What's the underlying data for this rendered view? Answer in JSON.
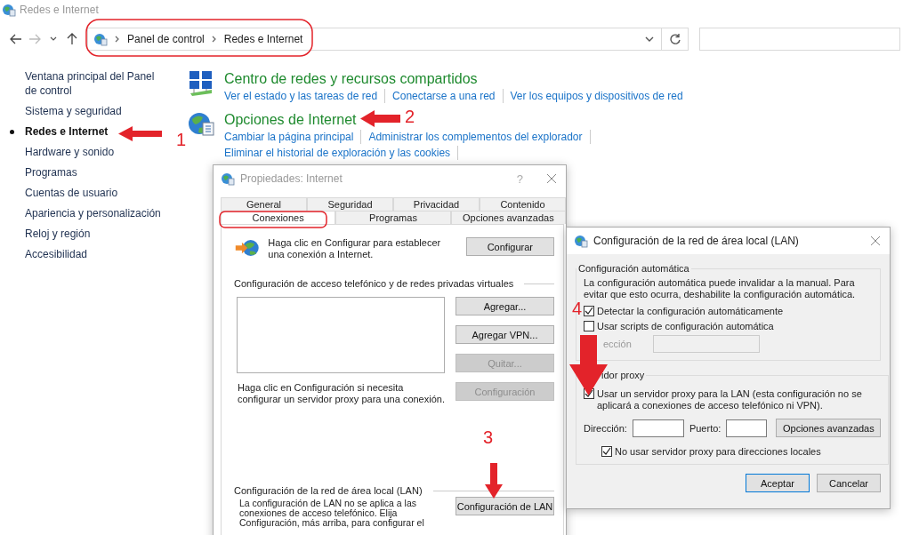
{
  "window": {
    "title": "Redes e Internet"
  },
  "breadcrumb": [
    "Panel de control",
    "Redes e Internet"
  ],
  "sidebar": {
    "items": [
      {
        "label": "Ventana principal del Panel de control",
        "selected": false
      },
      {
        "label": "Sistema y seguridad",
        "selected": false
      },
      {
        "label": "Redes e Internet",
        "selected": true
      },
      {
        "label": "Hardware y sonido",
        "selected": false
      },
      {
        "label": "Programas",
        "selected": false
      },
      {
        "label": "Cuentas de usuario",
        "selected": false
      },
      {
        "label": "Apariencia y personalización",
        "selected": false
      },
      {
        "label": "Reloj y región",
        "selected": false
      },
      {
        "label": "Accesibilidad",
        "selected": false
      }
    ]
  },
  "categories": [
    {
      "title": "Centro de redes y recursos compartidos",
      "kind": "network",
      "links": [
        "Ver el estado y las tareas de red",
        "Conectarse a una red",
        "Ver los equipos y dispositivos de red"
      ]
    },
    {
      "title": "Opciones de Internet",
      "kind": "globe",
      "links": [
        "Cambiar la página principal",
        "Administrar los complementos del explorador",
        "Eliminar el historial de exploración y las cookies"
      ]
    }
  ],
  "internet_properties": {
    "title": "Propiedades: Internet",
    "help": "?",
    "tabs_row_1": [
      {
        "label": "General",
        "selected": false
      },
      {
        "label": "Seguridad",
        "selected": false
      },
      {
        "label": "Privacidad",
        "selected": false
      },
      {
        "label": "Contenido",
        "selected": false
      }
    ],
    "tabs_row_2": [
      {
        "label": "Conexiones",
        "selected": true
      },
      {
        "label": "Programas",
        "selected": false
      },
      {
        "label": "Opciones avanzadas",
        "selected": false
      }
    ],
    "setup_text": "Haga clic en Configurar para establecer una conexión a Internet.",
    "setup_button": {
      "label": "Configurar",
      "disabled": false
    },
    "dialup_heading": "Configuración de acceso telefónico y de redes privadas virtuales",
    "dialup_buttons": [
      {
        "label": "Agregar...",
        "disabled": false
      },
      {
        "label": "Agregar VPN...",
        "disabled": false
      },
      {
        "label": "Quitar...",
        "disabled": true
      }
    ],
    "proxy_text": "Haga clic en Configuración si necesita configurar un servidor proxy para una conexión.",
    "settings_button": {
      "label": "Configuración",
      "disabled": true
    },
    "lan_heading": "Configuración de la red de área local (LAN)",
    "lan_text": "La configuración de LAN no se aplica a las conexiones de acceso telefónico. Elija Configuración, más arriba, para configurar el",
    "lan_button": {
      "label": "Configuración de LAN",
      "disabled": false
    }
  },
  "lan_dialog": {
    "title": "Configuración de la red de área local (LAN)",
    "auto_legend": "Configuración automática",
    "auto_note": "La configuración automática puede invalidar a la manual. Para evitar que esto ocurra, deshabilite la configuración automática.",
    "auto_checks": [
      {
        "label": "Detectar la configuración automáticamente",
        "checked": true
      },
      {
        "label": "Usar scripts de configuración automática",
        "checked": false
      }
    ],
    "script_address_label": "ección",
    "proxy_legend": "idor proxy",
    "proxy_check": {
      "label": "Usar un servidor proxy para la LAN (esta configuración no se aplicará a conexiones de acceso telefónico ni VPN).",
      "checked": true
    },
    "address_label": "Dirección:",
    "port_label": "Puerto:",
    "advanced_button": "Opciones avanzadas",
    "bypass_check": {
      "label": "No usar servidor proxy para direcciones locales",
      "checked": true
    },
    "buttons": [
      {
        "label": "Aceptar",
        "primary": true
      },
      {
        "label": "Cancelar",
        "primary": false
      }
    ]
  },
  "annotations": [
    "1",
    "2",
    "3",
    "4"
  ]
}
